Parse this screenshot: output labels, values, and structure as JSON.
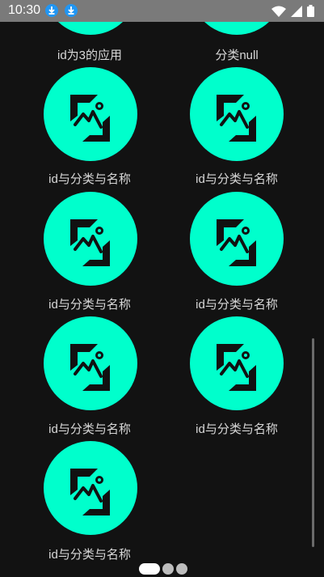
{
  "status_bar": {
    "time": "10:30",
    "icons": [
      "download-icon",
      "download-icon",
      "wifi-icon",
      "signal-icon",
      "battery-icon"
    ]
  },
  "apps": [
    {
      "label": "id为3的应用",
      "icon": "image-placeholder-icon"
    },
    {
      "label": "分类null",
      "icon": "image-placeholder-icon"
    },
    {
      "label": "id与分类与名称",
      "icon": "image-placeholder-icon"
    },
    {
      "label": "id与分类与名称",
      "icon": "image-placeholder-icon"
    },
    {
      "label": "id与分类与名称",
      "icon": "image-placeholder-icon"
    },
    {
      "label": "id与分类与名称",
      "icon": "image-placeholder-icon"
    },
    {
      "label": "id与分类与名称",
      "icon": "image-placeholder-icon"
    },
    {
      "label": "id与分类与名称",
      "icon": "image-placeholder-icon"
    },
    {
      "label": "id与分类与名称",
      "icon": "image-placeholder-icon"
    }
  ],
  "pager": {
    "pages": 3,
    "current": 1
  },
  "colors": {
    "background": "#121212",
    "icon_circle": "#00ffcc",
    "status_bar": "#7a7a7a",
    "label_text": "#d8d8d8"
  }
}
